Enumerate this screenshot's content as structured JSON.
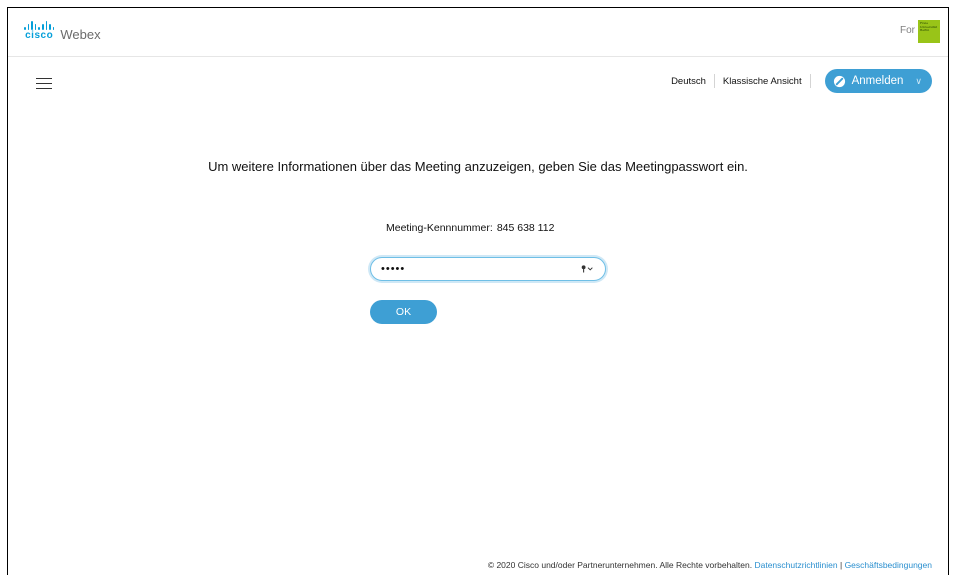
{
  "brand": {
    "cisco": "cisco",
    "product": "Webex",
    "for_label": "For",
    "partner_logo_lines": [
      "Freie",
      "Universität",
      "Berlin"
    ],
    "accent": "#049fd9",
    "partner_color": "#99c418"
  },
  "nav": {
    "menu_icon": "hamburger-icon",
    "language": "Deutsch",
    "classic_view": "Klassische Ansicht",
    "signin_label": "Anmelden",
    "signin_color": "#3e9fd4"
  },
  "main": {
    "info_text": "Um weitere Informationen über das Meeting anzuzeigen, geben Sie das Meetingpasswort ein.",
    "meeting_number_label": "Meeting-Kennnummer:",
    "meeting_number_value": "845 638 112",
    "password_value": "•••••",
    "ok_label": "OK"
  },
  "footer": {
    "copyright": "© 2020 Cisco und/oder Partnerunternehmen. Alle Rechte vorbehalten.",
    "privacy_link": "Datenschutzrichtlinien",
    "separator": " | ",
    "terms_link": "Geschäftsbedingungen"
  }
}
